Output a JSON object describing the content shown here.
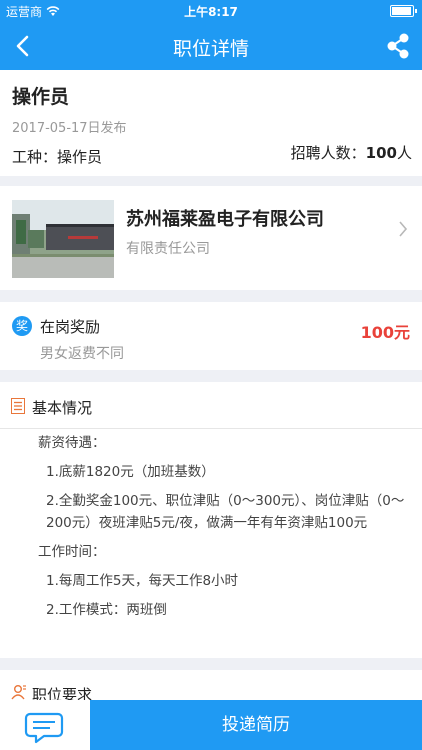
{
  "status_bar": {
    "carrier": "运营商",
    "wifi_icon": "wifi-icon",
    "time": "上午8:17",
    "battery_icon": "battery-icon"
  },
  "nav": {
    "back_icon": "chevron-left-icon",
    "title": "职位详情",
    "share_icon": "share-icon"
  },
  "job": {
    "title": "操作员",
    "publish_date": "2017-05-17日发布",
    "type_label": "工种：",
    "type_value": "操作员",
    "recruit_label": "招聘人数：",
    "recruit_count": "100",
    "recruit_unit": "人"
  },
  "company": {
    "name": "苏州福莱盈电子有限公司",
    "kind": "有限责任公司",
    "photo": "company-building-photo"
  },
  "reward": {
    "icon_text": "奖",
    "title": "在岗奖励",
    "subtitle": "男女返费不同",
    "amount": "100元"
  },
  "basic": {
    "title": "基本情况",
    "salary_heading": "薪资待遇：",
    "salary_item1": "1.底薪1820元（加班基数）",
    "salary_item2": "2.全勤奖金100元、职位津贴（0～300元）、岗位津贴（0～200元）夜班津贴5元/夜，做满一年有年资津贴100元",
    "work_heading": "工作时间：",
    "work_item1": "1.每周工作5天，每天工作8小时",
    "work_item2": "2.工作模式：两班倒"
  },
  "requirement": {
    "title": "职位要求"
  },
  "bottom": {
    "chat_icon": "chat-bubble-icon",
    "apply_label": "投递简历"
  },
  "colors": {
    "brand_blue": "#1f9af3",
    "reward_red": "#e9423a",
    "background": "#eef0f5"
  }
}
